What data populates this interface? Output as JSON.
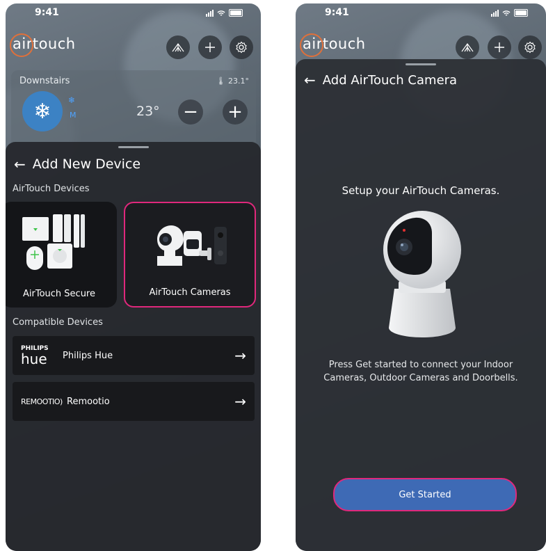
{
  "status": {
    "time": "9:41"
  },
  "app": {
    "logo_text": "airtouch",
    "accent_color": "#e0703a",
    "highlight_color": "#e0287c"
  },
  "zone": {
    "name": "Downstairs",
    "current_temp": "23.1°",
    "setpoint": "23°",
    "mode_label": "M"
  },
  "add_device": {
    "title": "Add New Device",
    "airtouch_section": "AirTouch Devices",
    "tiles": [
      {
        "label": "AirTouch Secure"
      },
      {
        "label": "AirTouch Cameras"
      }
    ],
    "compatible_section": "Compatible Devices",
    "compatible": [
      {
        "brand_top": "PHILIPS",
        "brand_bottom": "hue",
        "label": "Philips Hue"
      },
      {
        "brand": "REMOOTIO",
        "label": "Remootio"
      }
    ]
  },
  "camera_setup": {
    "title": "Add AirTouch Camera",
    "heading": "Setup your AirTouch Cameras.",
    "description_line1": "Press Get started to connect your Indoor",
    "description_line2": "Cameras, Outdoor Cameras and Doorbells.",
    "button": "Get Started"
  },
  "icons": [
    "signal-icon",
    "wifi-icon",
    "battery-icon",
    "sensor-icon",
    "plus-icon",
    "gear-icon",
    "snowflake-icon",
    "minus-icon",
    "back-arrow-icon",
    "forward-arrow-icon",
    "thermometer-icon"
  ]
}
